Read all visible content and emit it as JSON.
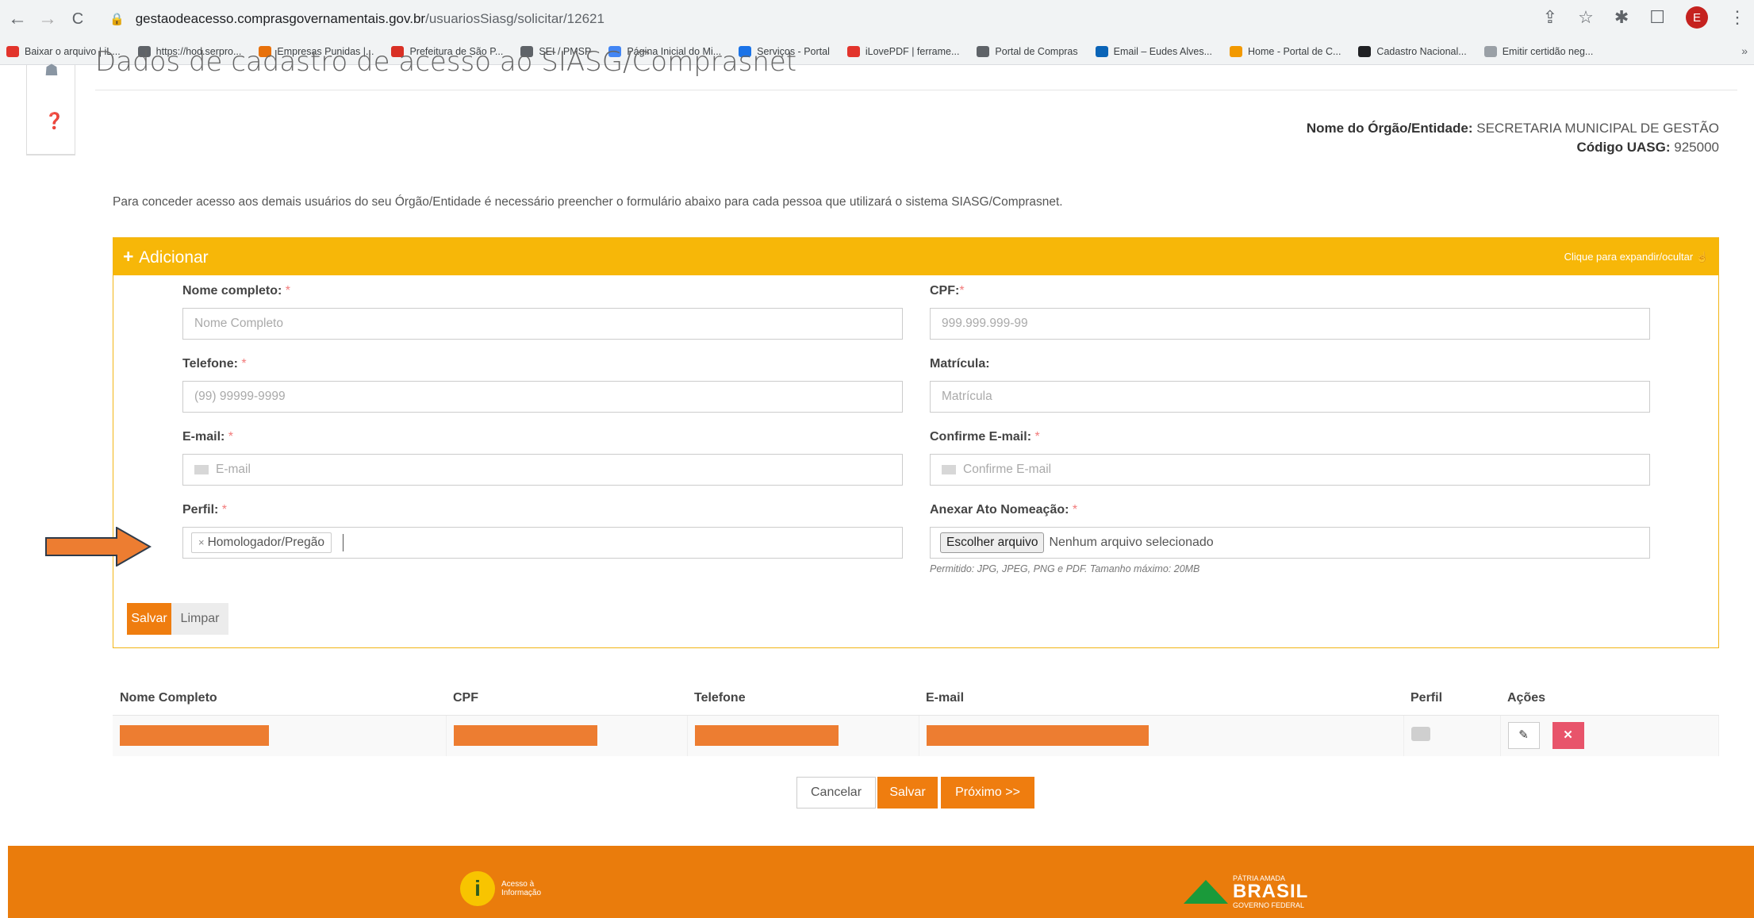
{
  "browser": {
    "url_host": "gestaodeacesso.comprasgovernamentais.gov.br",
    "url_path": "/usuariosSiasg/solicitar/12621",
    "profile_initial": "E",
    "bookmarks": [
      {
        "label": "Baixar o arquivo | iL...",
        "color": "#e2342c"
      },
      {
        "label": "https://hod.serpro...",
        "color": "#5f6368"
      },
      {
        "label": "Empresas Punidas |...",
        "color": "#e8710a"
      },
      {
        "label": "Prefeitura de São P...",
        "color": "#d93025"
      },
      {
        "label": "SEI / PMSP",
        "color": "#5f6368"
      },
      {
        "label": "Página Inicial do Mi...",
        "color": "#4285f4"
      },
      {
        "label": "Serviços - Portal",
        "color": "#1a73e8"
      },
      {
        "label": "iLovePDF | ferrame...",
        "color": "#e2342c"
      },
      {
        "label": "Portal de Compras",
        "color": "#5f6368"
      },
      {
        "label": "Email – Eudes Alves...",
        "color": "#0a64b7"
      },
      {
        "label": "Home - Portal de C...",
        "color": "#f29900"
      },
      {
        "label": "Cadastro Nacional...",
        "color": "#202124"
      },
      {
        "label": "Emitir certidão neg...",
        "color": "#9aa0a6"
      }
    ],
    "more": "»"
  },
  "page": {
    "title": "Dados de cadastro de acesso ao SIASG/Comprasnet",
    "org_label": "Nome do Órgão/Entidade:",
    "org_value": "SECRETARIA MUNICIPAL DE GESTÃO",
    "uasg_label": "Código UASG:",
    "uasg_value": "925000",
    "intro": "Para conceder acesso aos demais usuários do seu Órgão/Entidade é necessário preencher o formulário abaixo para cada pessoa que utilizará o sistema SIASG/Comprasnet."
  },
  "panel": {
    "plus": "+",
    "title": "Adicionar",
    "hint": "Clique para expandir/ocultar ☝"
  },
  "form": {
    "nome_label": "Nome completo:",
    "nome_placeholder": "Nome Completo",
    "cpf_label": "CPF:",
    "cpf_placeholder": "999.999.999-99",
    "telefone_label": "Telefone:",
    "telefone_placeholder": "(99) 99999-9999",
    "matricula_label": "Matrícula:",
    "matricula_placeholder": "Matrícula",
    "email_label": "E-mail:",
    "email_placeholder": "E-mail",
    "confirm_label": "Confirme E-mail:",
    "confirm_placeholder": "Confirme E-mail",
    "perfil_label": "Perfil:",
    "perfil_tag": "Homologador/Pregão",
    "anexo_label": "Anexar Ato Nomeação:",
    "file_button": "Escolher arquivo",
    "file_status": "Nenhum arquivo selecionado",
    "file_note": "Permitido: JPG, JPEG, PNG e PDF. Tamanho máximo: 20MB",
    "required_mark": "*",
    "save": "Salvar",
    "clear": "Limpar"
  },
  "table": {
    "headers": [
      "Nome Completo",
      "CPF",
      "Telefone",
      "E-mail",
      "Perfil",
      "Ações"
    ]
  },
  "actions": {
    "cancel": "Cancelar",
    "save": "Salvar",
    "next": "Próximo >>"
  },
  "footer": {
    "acesso_line1": "Acesso à",
    "acesso_line2": "Informação",
    "brasil_top": "PÁTRIA AMADA",
    "brasil_main": "BRASIL",
    "brasil_sub": "GOVERNO FEDERAL"
  },
  "colors": {
    "panel_header": "#f7b708",
    "primary_button": "#ef7d0f",
    "footer": "#ea7c0c",
    "redaction": "#ed7d31",
    "annotation_arrow": "#ed7d31"
  }
}
